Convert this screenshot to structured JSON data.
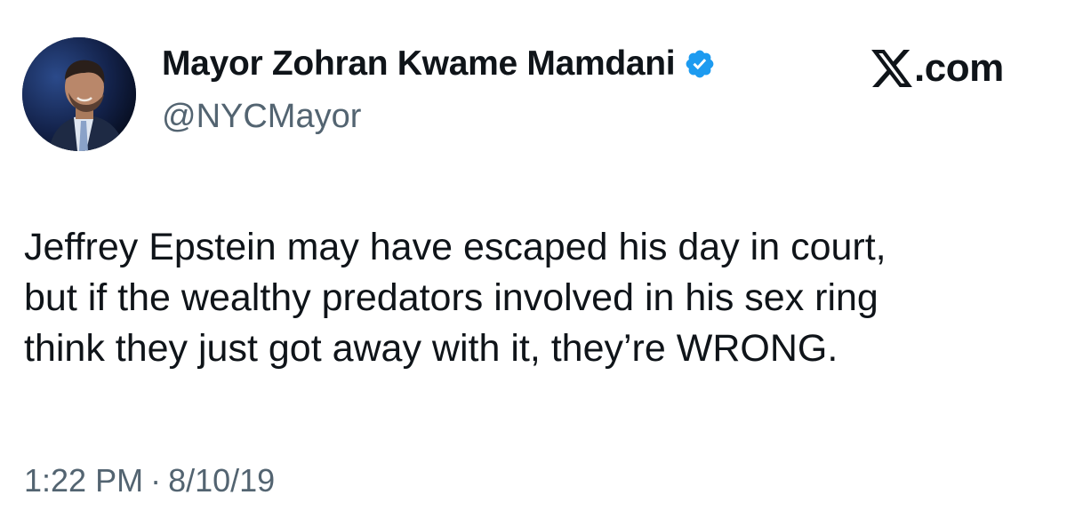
{
  "author": {
    "display_name": "Mayor Zohran Kwame Mamdani",
    "handle": "@NYCMayor",
    "verified": true,
    "verified_color": "#1d9bf0",
    "avatar_icon": "avatar-photo"
  },
  "platform": {
    "logo_icon": "x-logo-icon",
    "domain_suffix": ".com"
  },
  "tweet": {
    "lines": [
      "Jeffrey Epstein may have escaped his day in court,",
      "but if the wealthy predators involved in his sex ring",
      "think they just got away with it, they’re WRONG."
    ],
    "time": "1:22 PM",
    "separator": "·",
    "date": "8/10/19"
  },
  "colors": {
    "text": "#0f1419",
    "secondary": "#536471",
    "background": "#ffffff"
  }
}
